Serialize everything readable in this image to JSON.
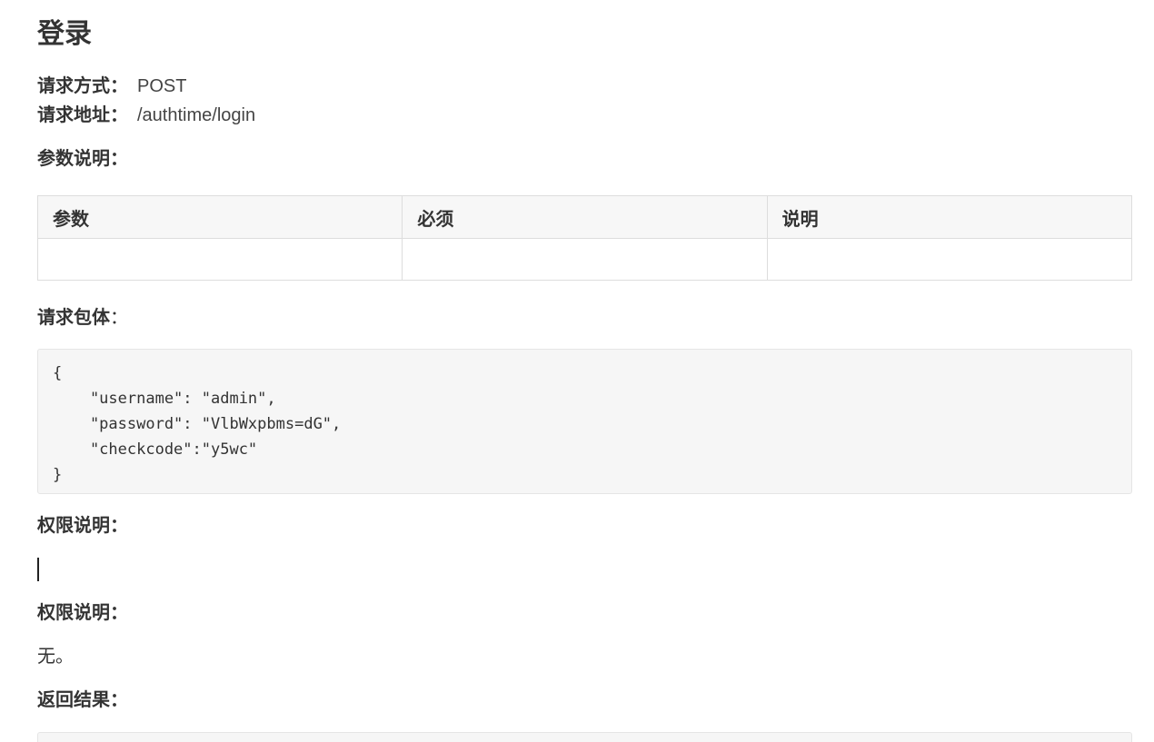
{
  "page": {
    "title": "登录"
  },
  "request": {
    "method_label": "请求方式：",
    "method_value": "POST",
    "address_label": "请求地址：",
    "address_value": "/authtime/login"
  },
  "params": {
    "heading": "参数说明：",
    "columns": [
      "参数",
      "必须",
      "说明"
    ],
    "rows": [
      [
        "",
        "",
        ""
      ]
    ]
  },
  "request_body": {
    "heading": "请求包体",
    "heading_colon": "：",
    "code": "{\n    \"username\": \"admin\",\n    \"password\": \"VlbWxpbms=dG\",\n    \"checkcode\":\"y5wc\"\n}"
  },
  "permissions": {
    "heading_1": "权限说明：",
    "heading_2": "权限说明：",
    "text": "无。"
  },
  "response": {
    "heading": "返回结果："
  }
}
